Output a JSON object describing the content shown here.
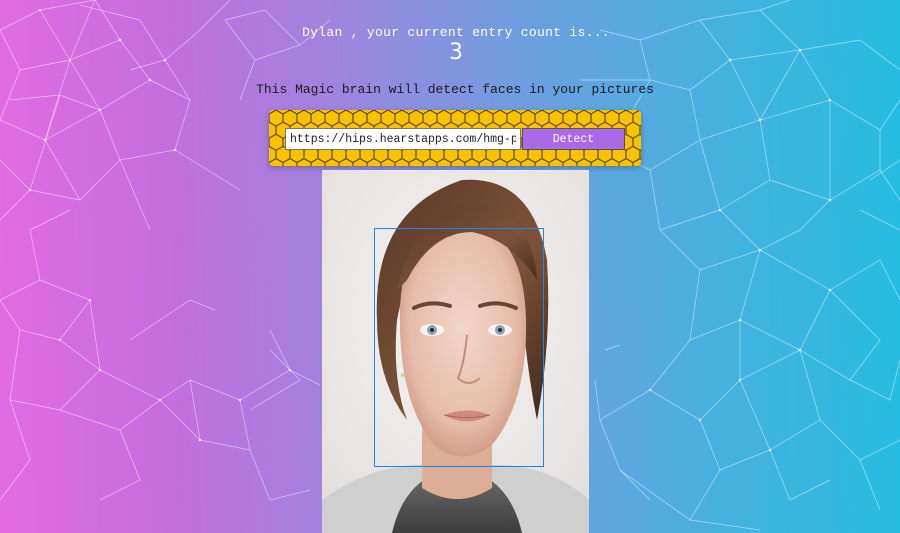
{
  "header": {
    "user_name": "Dylan",
    "greeting": "Dylan , your current entry count is...",
    "entry_count": "3"
  },
  "tagline": "This Magic brain will detect faces in your pictures",
  "form": {
    "url_value": "https://hips.hearstapps.com/hmg-prod",
    "detect_label": "Detect"
  },
  "colors": {
    "gradient_left": "#e26be0",
    "gradient_right": "#25bde1",
    "panel": "#f7c200",
    "button": "#a86ae6",
    "face_box": "#1f86e6"
  },
  "image": {
    "description_icon": "face-photo",
    "detected_faces": 1
  }
}
